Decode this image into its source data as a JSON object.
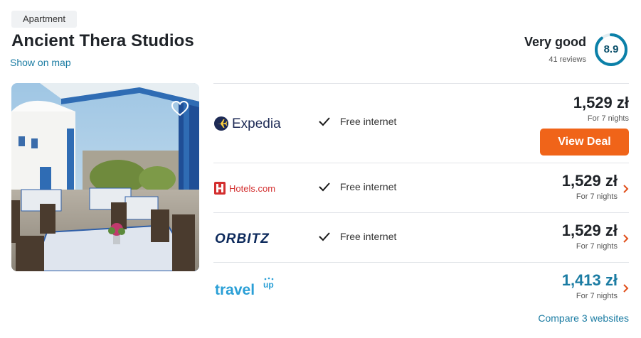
{
  "property": {
    "type_badge": "Apartment",
    "name": "Ancient Thera Studios",
    "map_link": "Show on map"
  },
  "rating": {
    "label": "Very good",
    "reviews": "41 reviews",
    "score": "8.9",
    "score_fraction": 0.89,
    "ring_color": "#0b80a8"
  },
  "photo": {
    "favorite_icon": "heart-outline-icon"
  },
  "offers": [
    {
      "provider": "Expedia",
      "amenity": "Free internet",
      "price": "1,529 zł",
      "nights": "For 7 nights",
      "cta": "View Deal",
      "cta_color": "#f06419"
    },
    {
      "provider": "Hotels.com",
      "amenity": "Free internet",
      "price": "1,529 zł",
      "nights": "For 7 nights"
    },
    {
      "provider": "ORBITZ",
      "amenity": "Free internet",
      "price": "1,529 zł",
      "nights": "For 7 nights"
    },
    {
      "provider": "travelup",
      "price": "1,413 zł",
      "nights": "For 7 nights",
      "price_color": "#1b7ca3"
    }
  ],
  "compare_link": "Compare 3 websites"
}
